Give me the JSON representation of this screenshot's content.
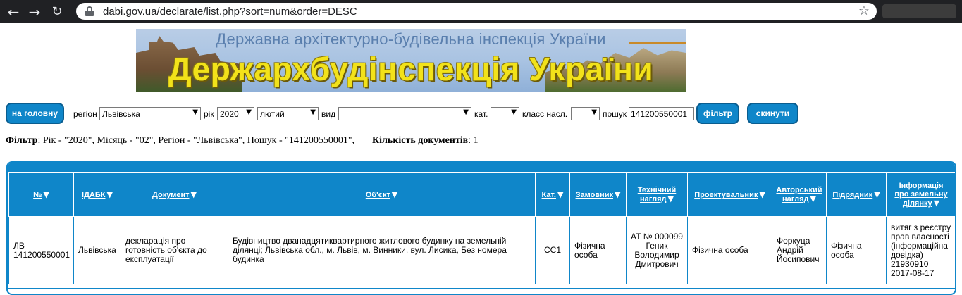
{
  "browser": {
    "url": "dabi.gov.ua/declarate/list.php?sort=num&order=DESC"
  },
  "banner": {
    "subtitle": "Державна архітектурно-будівельна інспекція України",
    "title": "Держархбудінспекція України"
  },
  "filter": {
    "home_button": "на головну",
    "region_label": "регіон",
    "region_value": "Львівська",
    "year_label": "рік",
    "year_value": "2020",
    "month_value": "лютий",
    "type_label": "вид",
    "type_value": "",
    "cat_label": "кат.",
    "cat_value": "",
    "class_label": "класс насл.",
    "class_value": "",
    "search_label": "пошук",
    "search_value": "141200550001",
    "filter_button": "фільтр",
    "reset_button": "скинути"
  },
  "summary": {
    "filter_label": "Фільтр",
    "filter_text": ": Рік - \"2020\", Місяць - \"02\", Регіон - \"Львівська\", Пошук - \"141200550001\",",
    "count_label": "Кількість документів",
    "count_text": ": 1"
  },
  "table": {
    "headers": [
      {
        "line1": "№",
        "line2": "",
        "line3": ""
      },
      {
        "line1": "ІДАБК",
        "line2": "",
        "line3": ""
      },
      {
        "line1": "Документ",
        "line2": "",
        "line3": ""
      },
      {
        "line1": "Об'єкт",
        "line2": "",
        "line3": ""
      },
      {
        "line1": "Кат.",
        "line2": "",
        "line3": ""
      },
      {
        "line1": "Замовник",
        "line2": "",
        "line3": ""
      },
      {
        "line1": "Технічний",
        "line2": "нагляд",
        "line3": ""
      },
      {
        "line1": "Проектувальник",
        "line2": "",
        "line3": ""
      },
      {
        "line1": "Авторський",
        "line2": "нагляд",
        "line3": ""
      },
      {
        "line1": "Підрядник",
        "line2": "",
        "line3": ""
      },
      {
        "line1": "Інформація",
        "line2": "про земельну",
        "line3": "ділянку"
      }
    ],
    "rows": [
      {
        "num": "ЛВ 141200550001",
        "idabk": "Львівська",
        "document": "декларація про готовність об'єкта до експлуатації",
        "object": "Будівництво дванадцятиквартирного житлового будинку на земельній ділянці; Львівська обл., м. Львів, м. Винники, вул. Лисика, Без номера будинка",
        "cat": "СС1",
        "customer": "Фізична особа",
        "tech_supervision": "АТ № 000099 Геник Володимир Дмитрович",
        "designer": "Фізична особа",
        "author_supervision": "Форкуца Андрій Йосипович",
        "contractor": "Фізична особа",
        "land_info": "витяг з реєстру прав власності (інформаційна довідка) 21930910 2017-08-17"
      }
    ]
  },
  "icons": {
    "back": "back-arrow-icon",
    "forward": "forward-arrow-icon",
    "reload": "reload-icon",
    "lock": "lock-icon",
    "star": "star-icon",
    "sort": "sort-triangle-icon",
    "dropdown": "dropdown-arrow-icon"
  },
  "colors": {
    "accent": "#0f86c9",
    "banner_title": "#f2e21a"
  }
}
